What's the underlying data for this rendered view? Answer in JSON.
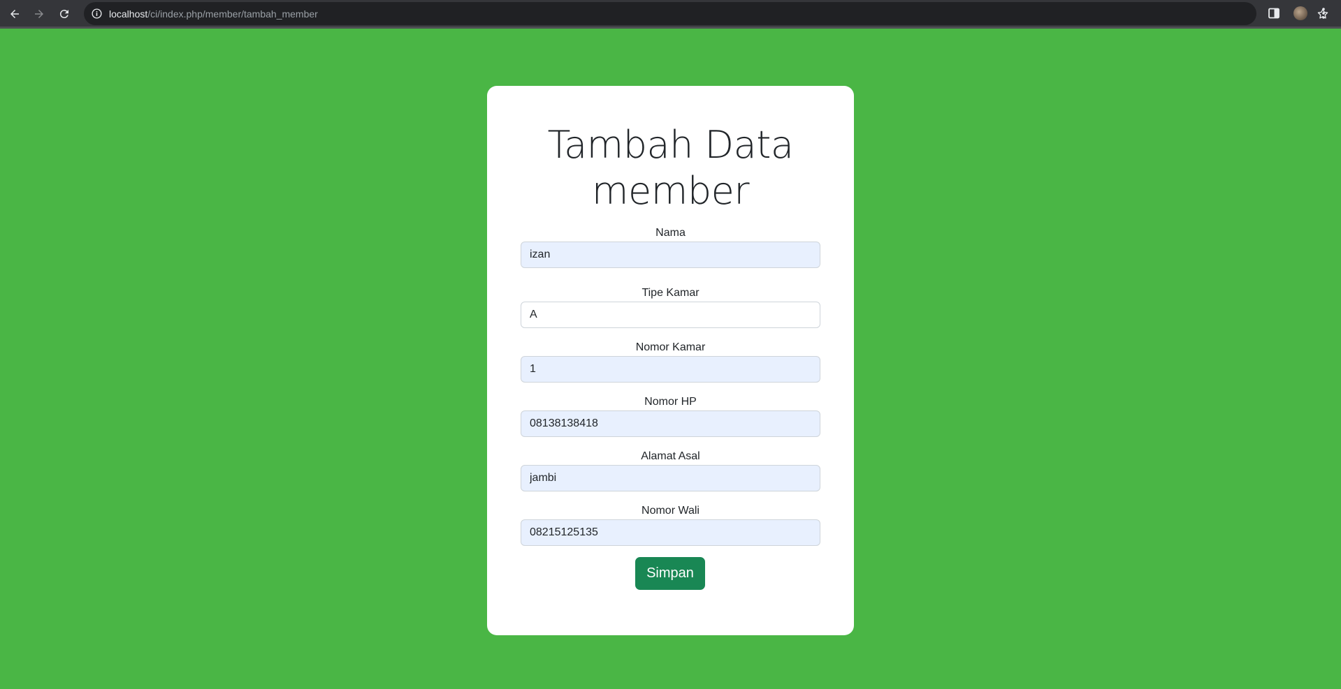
{
  "browser": {
    "url_host": "localhost",
    "url_path": "/ci/index.php/member/tambah_member"
  },
  "form": {
    "title_line1": "Tambah Data",
    "title_line2": "member",
    "fields": [
      {
        "label": "Nama",
        "value": "izan"
      },
      {
        "label": "Tipe Kamar",
        "value": "A"
      },
      {
        "label": "Nomor Kamar",
        "value": "1"
      },
      {
        "label": "Nomor HP",
        "value": "08138138418"
      },
      {
        "label": "Alamat Asal",
        "value": "jambi"
      },
      {
        "label": "Nomor Wali",
        "value": "08215125135"
      }
    ],
    "submit_label": "Simpan"
  },
  "colors": {
    "page_background": "#4ab645",
    "button": "#198754",
    "autofill_input": "#e8f0fe"
  }
}
